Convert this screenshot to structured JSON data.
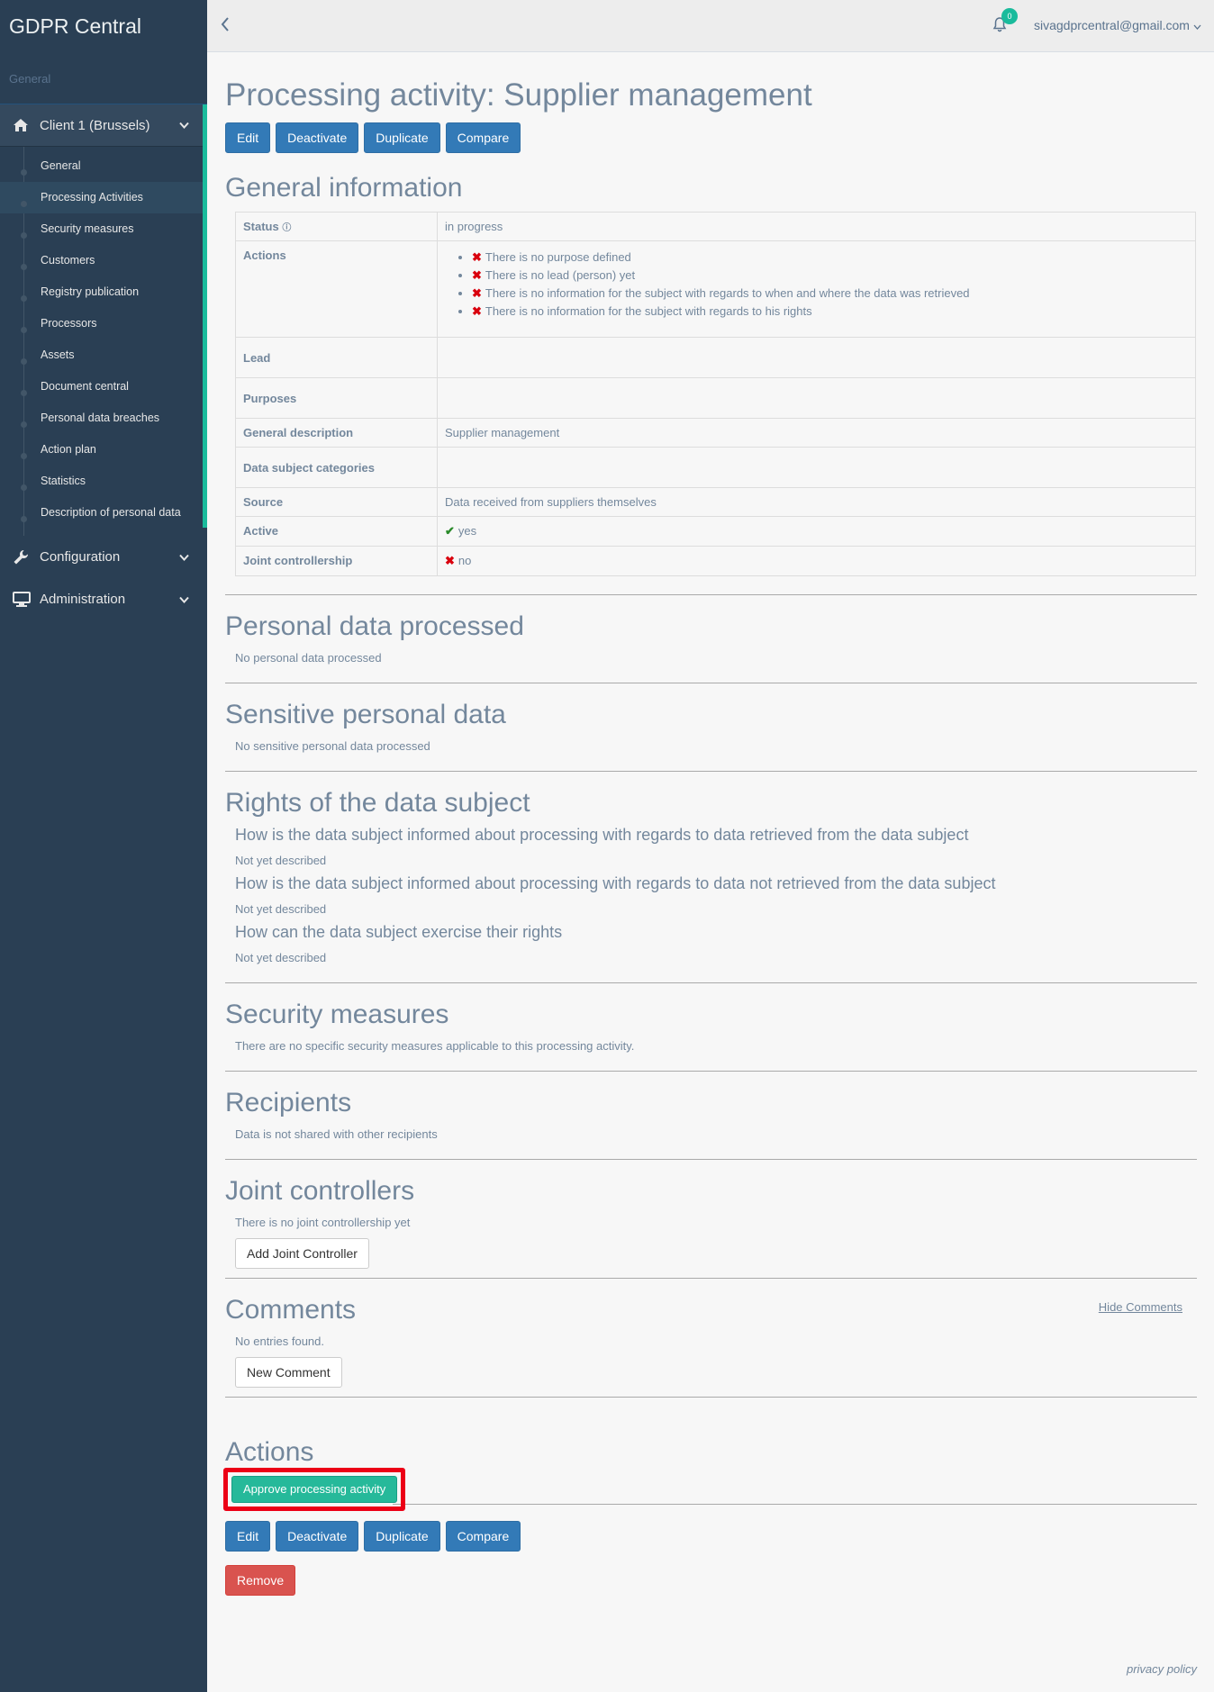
{
  "app": {
    "brand": "GDPR Central",
    "section": "General"
  },
  "sidebar": {
    "client_label": "Client 1 (Brussels)",
    "items": [
      {
        "label": "General"
      },
      {
        "label": "Processing Activities"
      },
      {
        "label": "Security measures"
      },
      {
        "label": "Customers"
      },
      {
        "label": "Registry publication"
      },
      {
        "label": "Processors"
      },
      {
        "label": "Assets"
      },
      {
        "label": "Document central"
      },
      {
        "label": "Personal data breaches"
      },
      {
        "label": "Action plan"
      },
      {
        "label": "Statistics"
      },
      {
        "label": "Description of personal data"
      }
    ],
    "configuration_label": "Configuration",
    "administration_label": "Administration"
  },
  "topnav": {
    "notification_count": "0",
    "user_email": "sivagdprcentral@gmail.com"
  },
  "page": {
    "title": "Processing activity: Supplier management",
    "buttons": {
      "edit": "Edit",
      "deactivate": "Deactivate",
      "duplicate": "Duplicate",
      "compare": "Compare",
      "remove": "Remove"
    }
  },
  "general": {
    "heading": "General information",
    "rows": {
      "status_k": "Status",
      "status_v": "in progress",
      "actions_k": "Actions",
      "actions": [
        "There is no purpose defined",
        "There is no lead (person) yet",
        "There is no information for the subject with regards to when and where the data was retrieved",
        "There is no information for the subject with regards to his rights"
      ],
      "lead_k": "Lead",
      "lead_v": "",
      "purposes_k": "Purposes",
      "purposes_v": "",
      "gen_desc_k": "General description",
      "gen_desc_v": "Supplier management",
      "dsc_k": "Data subject categories",
      "dsc_v": "",
      "source_k": "Source",
      "source_v": "Data received from suppliers themselves",
      "active_k": "Active",
      "active_v": "yes",
      "joint_k": "Joint controllership",
      "joint_v": "no"
    }
  },
  "personal_data": {
    "heading": "Personal data processed",
    "text": "No personal data processed"
  },
  "sensitive": {
    "heading": "Sensitive personal data",
    "text": "No sensitive personal data processed"
  },
  "rights": {
    "heading": "Rights of the data subject",
    "q1": "How is the data subject informed about processing with regards to data retrieved from the data subject",
    "a1": "Not yet described",
    "q2": "How is the data subject informed about processing with regards to data not retrieved from the data subject",
    "a2": "Not yet described",
    "q3": "How can the data subject exercise their rights",
    "a3": "Not yet described"
  },
  "security": {
    "heading": "Security measures",
    "text": "There are no specific security measures applicable to this processing activity."
  },
  "recipients": {
    "heading": "Recipients",
    "text": "Data is not shared with other recipients"
  },
  "joint": {
    "heading": "Joint controllers",
    "text": "There is no joint controllership yet",
    "button": "Add Joint Controller"
  },
  "comments": {
    "heading": "Comments",
    "hide_link": "Hide Comments",
    "text": "No entries found.",
    "button": "New Comment"
  },
  "actions": {
    "heading": "Actions",
    "approve_button": "Approve processing activity"
  },
  "footer": {
    "privacy": "privacy policy"
  },
  "colors": {
    "sidebar": "#2a3f54",
    "accent": "#1abb9c",
    "primary": "#337ab7",
    "danger": "#d9534f",
    "highlight": "#ec0016"
  }
}
